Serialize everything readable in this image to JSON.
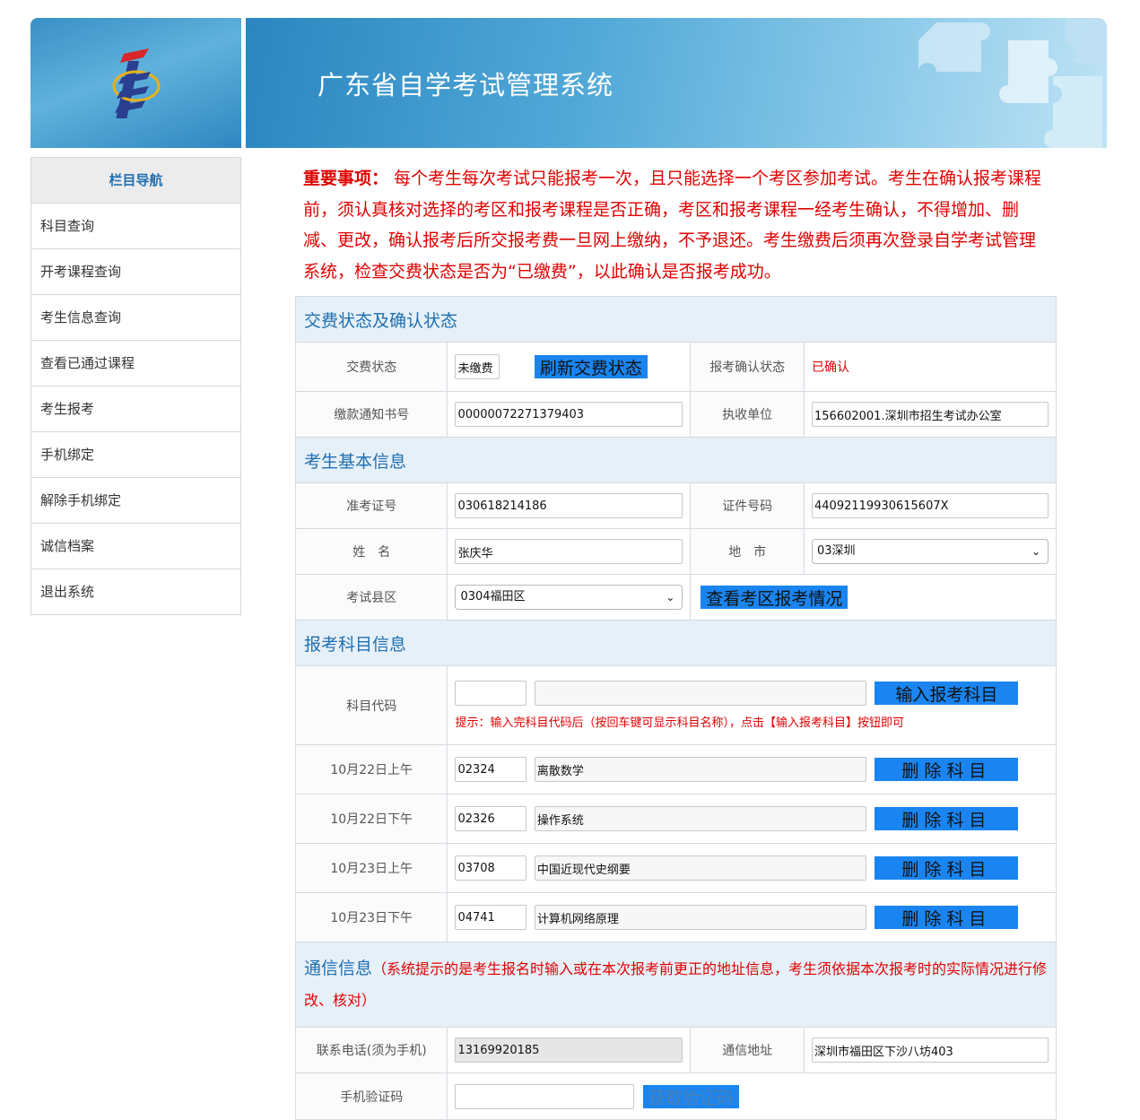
{
  "header": {
    "title": "广东省自学考试管理系统"
  },
  "sidebar": {
    "heading": "栏目导航",
    "items": [
      {
        "label": "科目查询"
      },
      {
        "label": "开考课程查询"
      },
      {
        "label": "考生信息查询"
      },
      {
        "label": "查看已通过课程"
      },
      {
        "label": "考生报考"
      },
      {
        "label": "手机绑定"
      },
      {
        "label": "解除手机绑定"
      },
      {
        "label": "诚信档案"
      },
      {
        "label": "退出系统"
      }
    ]
  },
  "notice": {
    "prefix": "重要事项：",
    "text": "  每个考生每次考试只能报考一次，且只能选择一个考区参加考试。考生在确认报考课程前，须认真核对选择的考区和报考课程是否正确，考区和报考课程一经考生确认，不得增加、删减、更改，确认报考后所交报考费一旦网上缴纳，不予退还。考生缴费后须再次登录自学考试管理系统，检查交费状态是否为“已缴费”，以此确认是否报考成功。"
  },
  "payment": {
    "section_title": "交费状态及确认状态",
    "status_label": "交费状态",
    "status_value": "未缴费",
    "refresh_button": "刷新交费状态",
    "confirm_label": "报考确认状态",
    "confirm_value": "已确认",
    "notice_no_label": "缴款通知书号",
    "notice_no_value": "00000072271379403",
    "unit_label": "执收单位",
    "unit_value": "156602001.深圳市招生考试办公室"
  },
  "basic": {
    "section_title": "考生基本信息",
    "exam_id_label": "准考证号",
    "exam_id_value": "030618214186",
    "cert_label": "证件号码",
    "cert_value": "44092119930615607X",
    "name_label": "姓　名",
    "name_value": "张庆华",
    "city_label": "地　市",
    "city_value": "03深圳",
    "district_label": "考试县区",
    "district_value": "0304福田区",
    "view_district_button": "查看考区报考情况"
  },
  "subjects": {
    "section_title": "报考科目信息",
    "code_label": "科目代码",
    "code_value": "",
    "name_value": "",
    "add_button": "输入报考科目",
    "hint": "提示：输入完科目代码后（按回车键可显示科目名称），点击【输入报考科目】按钮即可",
    "delete_button": "删除科目",
    "rows": [
      {
        "time": "10月22日上午",
        "code": "02324",
        "name": "离散数学"
      },
      {
        "time": "10月22日下午",
        "code": "02326",
        "name": "操作系统"
      },
      {
        "time": "10月23日上午",
        "code": "03708",
        "name": "中国近现代史纲要"
      },
      {
        "time": "10月23日下午",
        "code": "04741",
        "name": "计算机网络原理"
      }
    ]
  },
  "contact": {
    "section_title": "通信信息",
    "section_note": "（系统提示的是考生报名时输入或在本次报考前更正的地址信息，考生须依据本次报考时的实际情况进行修改、核对）",
    "phone_label": "联系电话(须为手机)",
    "phone_value": "13169920185",
    "address_label": "通信地址",
    "address_value": "深圳市福田区下沙八坊403",
    "sms_label": "手机验证码",
    "sms_value": "",
    "sms_button": "获取验证码"
  },
  "colors": {
    "accent": "#1f6fb2",
    "button": "#1a85f0",
    "warning": "#e00000",
    "section_bg": "#e6f0f8"
  }
}
